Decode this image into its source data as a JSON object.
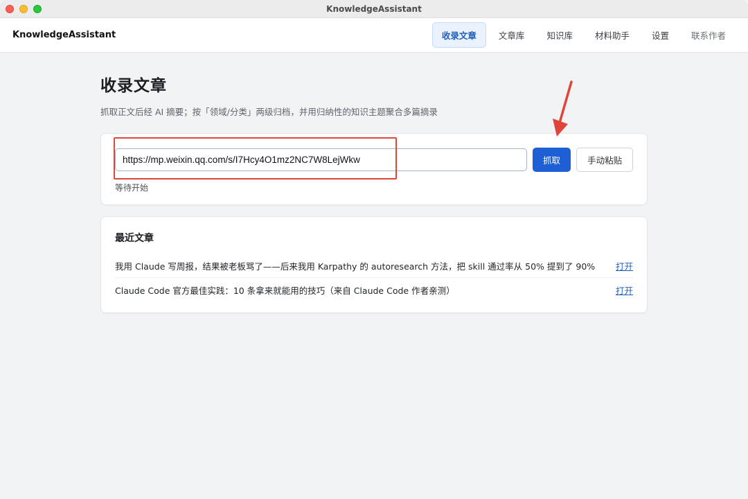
{
  "window": {
    "title": "KnowledgeAssistant"
  },
  "header": {
    "brand": "KnowledgeAssistant",
    "nav": [
      {
        "label": "收录文章",
        "active": true
      },
      {
        "label": "文章库"
      },
      {
        "label": "知识库"
      },
      {
        "label": "材料助手"
      },
      {
        "label": "设置"
      },
      {
        "label": "联系作者"
      }
    ]
  },
  "main": {
    "title": "收录文章",
    "subtitle": "抓取正文后经 AI 摘要；按「领域/分类」两级归档，并用归纳性的知识主题聚合多篇摘录",
    "fetch": {
      "url_value": "https://mp.weixin.qq.com/s/I7Hcy4O1mz2NC7W8LejWkw",
      "fetch_label": "抓取",
      "paste_label": "手动粘贴",
      "status": "等待开始"
    },
    "recent": {
      "title": "最近文章",
      "items": [
        {
          "title": "我用 Claude 写周报，结果被老板骂了——后来我用 Karpathy 的 autoresearch 方法，把 skill 通过率从 50% 提到了 90%",
          "action": "打开"
        },
        {
          "title": "Claude Code 官方最佳实践：10 条拿来就能用的技巧（来自 Claude Code 作者亲测）",
          "action": "打开"
        }
      ]
    }
  },
  "colors": {
    "accent": "#1f5fd6",
    "annotation": "#e0453c"
  }
}
